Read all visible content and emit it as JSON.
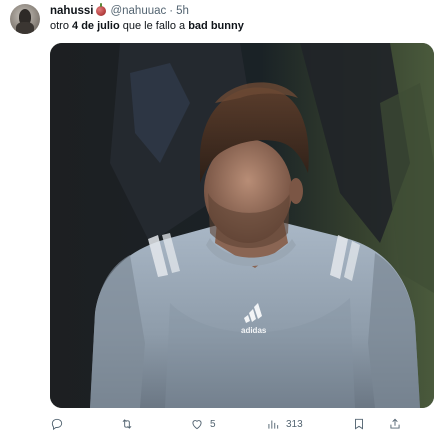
{
  "tweet": {
    "author_name": "nahussi",
    "emoji_icon": "apple-emoji-icon",
    "handle": "@nahuuac",
    "separator": "·",
    "time": "5h",
    "text": {
      "part1": "otro ",
      "bold1": "4 de julio",
      "part2": " que le fallo a ",
      "bold2": "bad bunny"
    },
    "media": {
      "logo_text": "adidas"
    }
  },
  "actions": {
    "reply": {
      "icon": "reply-icon",
      "count": ""
    },
    "retweet": {
      "icon": "retweet-icon",
      "count": ""
    },
    "like": {
      "icon": "heart-icon",
      "count": "5"
    },
    "views": {
      "icon": "views-icon",
      "count": "313"
    },
    "bookmark": {
      "icon": "bookmark-icon",
      "count": ""
    },
    "share": {
      "icon": "share-icon",
      "count": ""
    }
  },
  "colors": {
    "text": "#0f1419",
    "secondary": "#536471"
  }
}
